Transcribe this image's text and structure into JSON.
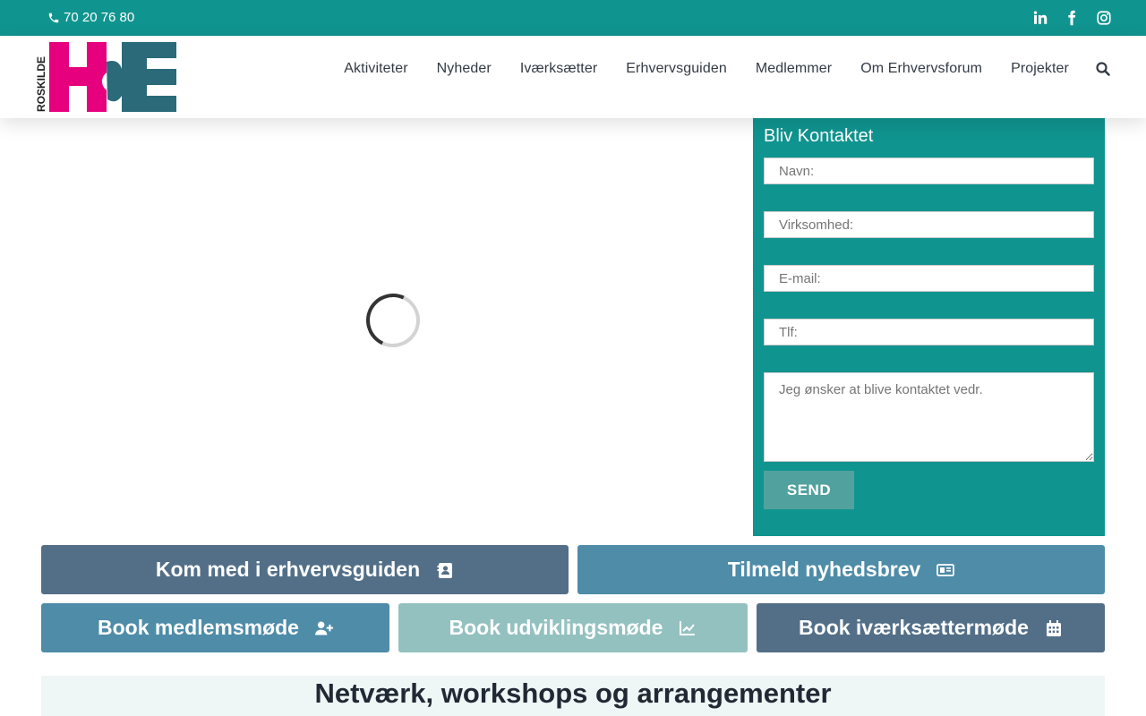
{
  "topbar": {
    "phone": "70 20 76 80",
    "social": [
      "linkedin-icon",
      "facebook-icon",
      "instagram-icon"
    ],
    "bg_color": "#10948f"
  },
  "header": {
    "logo_text": "ROSKILDE",
    "nav": [
      "Aktiviteter",
      "Nyheder",
      "Iværksætter",
      "Erhvervsguiden",
      "Medlemmer",
      "Om Erhvervsforum",
      "Projekter"
    ]
  },
  "contact": {
    "title": "Bliv Kontaktet",
    "name_placeholder": "Navn:",
    "company_placeholder": "Virksomhed:",
    "email_placeholder": "E-mail:",
    "phone_placeholder": "Tlf:",
    "message_placeholder": "Jeg ønsker at blive kontaktet vedr.",
    "send_label": "SEND"
  },
  "cta": {
    "guide": "Kom med i erhvervsguiden",
    "newsletter": "Tilmeld nyhedsbrev",
    "member_meeting": "Book medlemsmøde",
    "development_meeting": "Book udviklingsmøde",
    "entrepreneur_meeting": "Book iværksættermøde"
  },
  "section": {
    "title": "Netværk, workshops og arrangementer"
  },
  "colors": {
    "teal": "#10948f",
    "slate": "#536f88",
    "blue": "#4e8ca8",
    "light_teal": "#93c1bf",
    "logo_pink": "#e6007e",
    "logo_teal": "#2a6a79"
  }
}
